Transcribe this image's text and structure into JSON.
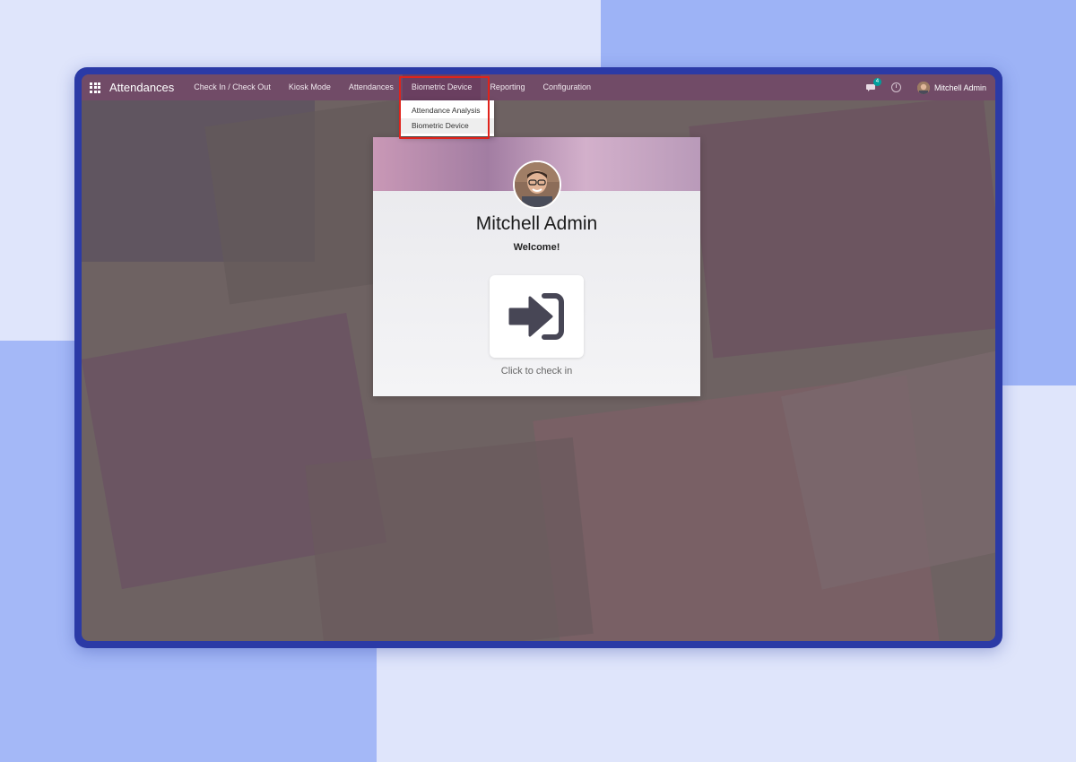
{
  "navbar": {
    "app_title": "Attendances",
    "items": [
      {
        "label": "Check In / Check Out"
      },
      {
        "label": "Kiosk Mode"
      },
      {
        "label": "Attendances"
      },
      {
        "label": "Biometric Device"
      },
      {
        "label": "Reporting"
      },
      {
        "label": "Configuration"
      }
    ],
    "active_item": "Biometric Device",
    "messages_count": "4",
    "user_name": "Mitchell Admin"
  },
  "dropdown": {
    "items": [
      {
        "label": "Attendance Analysis"
      },
      {
        "label": "Biometric Device"
      }
    ],
    "highlighted": "Biometric Device"
  },
  "card": {
    "name": "Mitchell Admin",
    "welcome": "Welcome!",
    "checkin_label": "Click to check in"
  },
  "colors": {
    "navbar": "#714b67",
    "highlight_box": "#e0231b",
    "frame": "#2b3aa6"
  },
  "icons": [
    "apps-grid-icon",
    "chat-icon",
    "clock-icon",
    "sign-in-icon"
  ]
}
